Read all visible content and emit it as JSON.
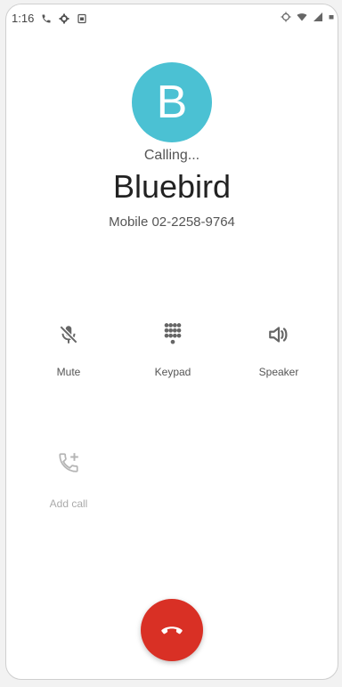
{
  "status_bar": {
    "time": "1:16",
    "left_icons": [
      "phone-icon",
      "settings-icon",
      "sim-icon"
    ],
    "right_icons": [
      "location-icon",
      "wifi-icon",
      "signal-icon",
      "battery-icon"
    ]
  },
  "contact": {
    "initial": "B",
    "avatar_color": "#4bc1d3",
    "call_status": "Calling...",
    "name": "Bluebird",
    "number": "Mobile 02-2258-9764"
  },
  "actions": {
    "mute": {
      "label": "Mute",
      "icon": "mic-off-icon"
    },
    "keypad": {
      "label": "Keypad",
      "icon": "dialpad-icon"
    },
    "speaker": {
      "label": "Speaker",
      "icon": "speaker-icon"
    },
    "add_call": {
      "label": "Add call",
      "icon": "add-call-icon"
    }
  },
  "end_call": {
    "icon": "end-call-icon",
    "color": "#d93025"
  }
}
